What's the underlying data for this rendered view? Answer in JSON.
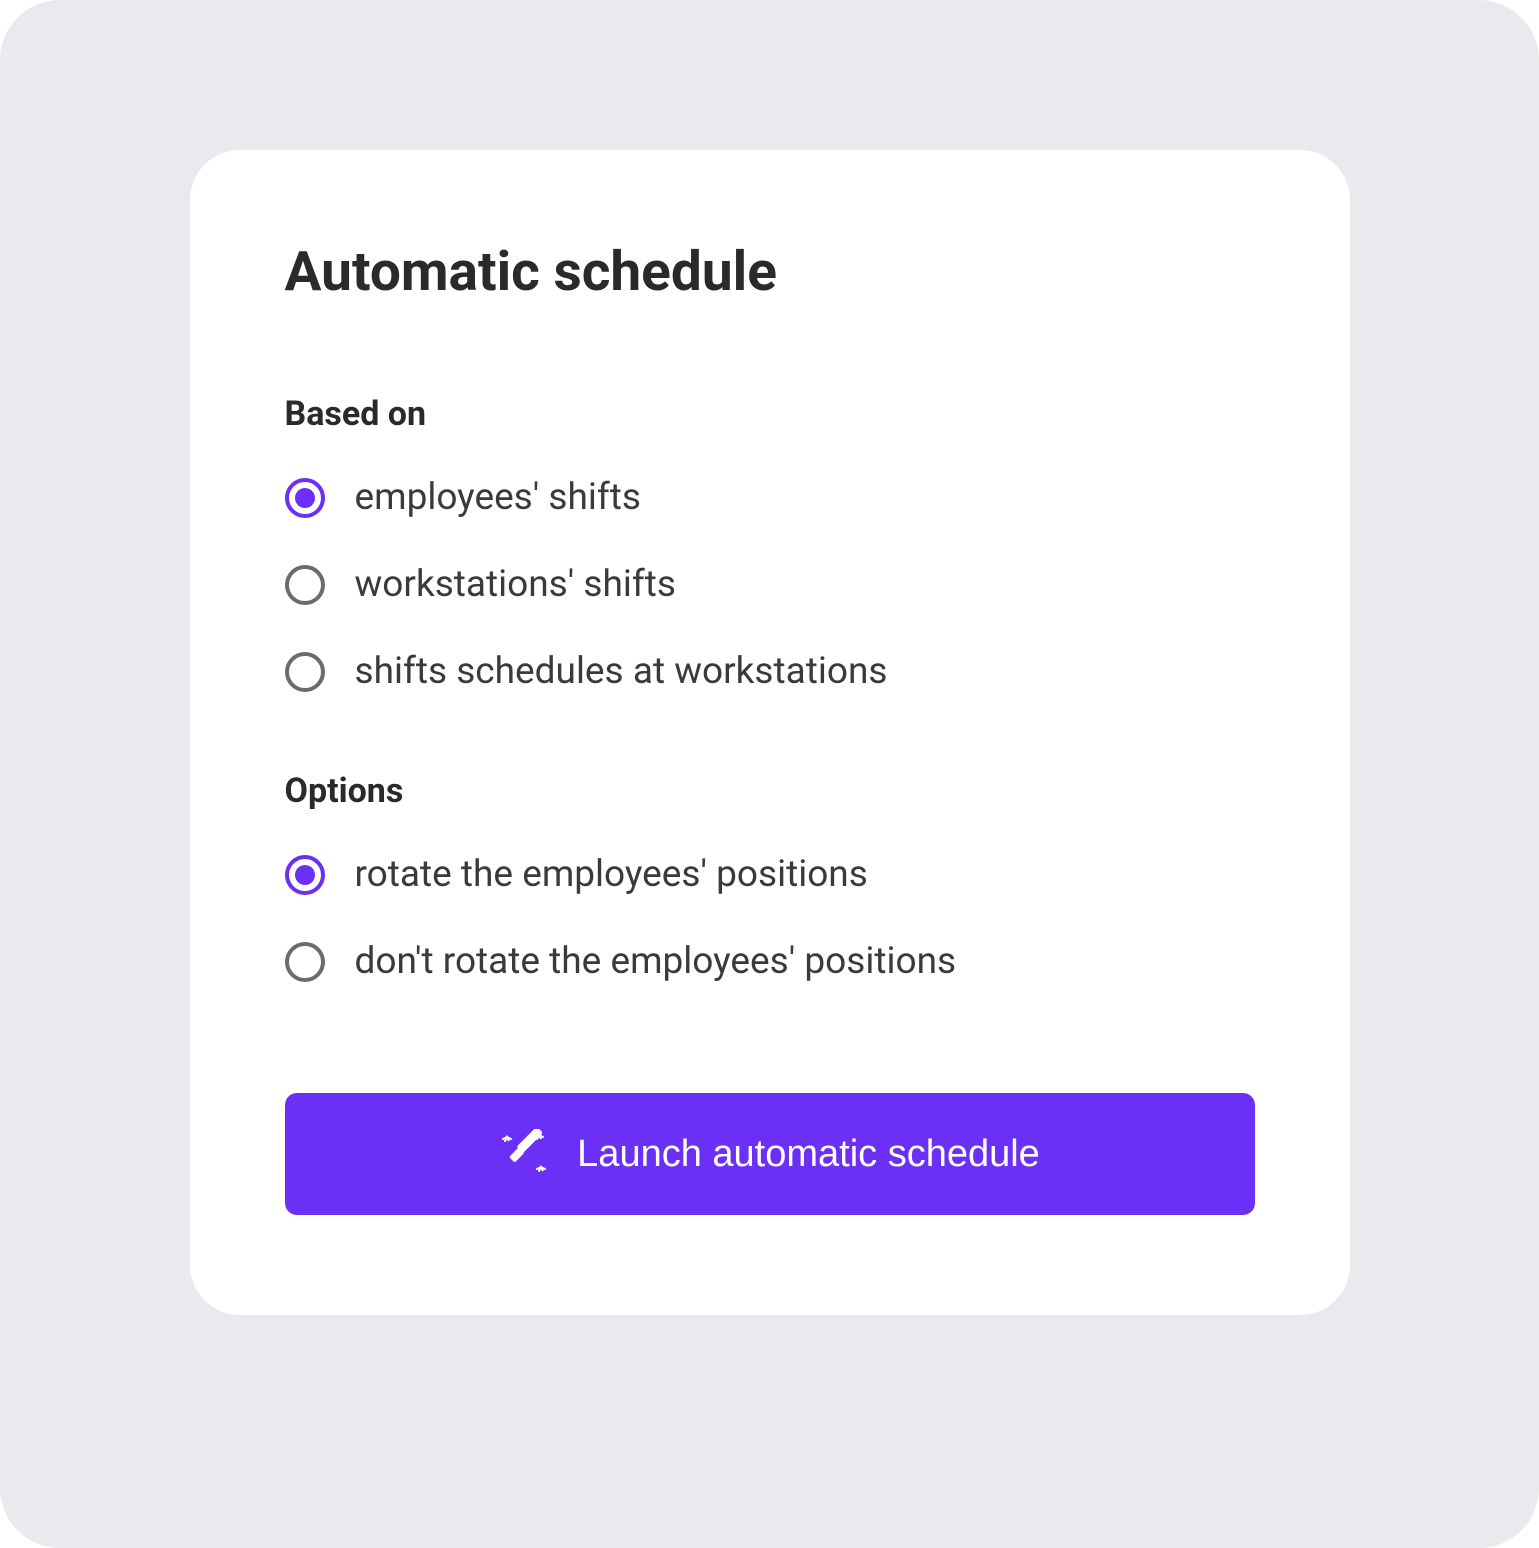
{
  "card": {
    "title": "Automatic schedule",
    "sections": {
      "basedOn": {
        "label": "Based on",
        "options": [
          {
            "label": "employees' shifts",
            "selected": true
          },
          {
            "label": "workstations' shifts",
            "selected": false
          },
          {
            "label": "shifts schedules at workstations",
            "selected": false
          }
        ]
      },
      "options": {
        "label": "Options",
        "options": [
          {
            "label": "rotate the employees' positions",
            "selected": true
          },
          {
            "label": "don't rotate the employees' positions",
            "selected": false
          }
        ]
      }
    },
    "button": {
      "label": "Launch automatic schedule"
    }
  },
  "colors": {
    "accent": "#6b2ff5",
    "background": "#e8eaed",
    "cardBackground": "#ffffff",
    "text": "#2a2a2a",
    "textSecondary": "#3a3a3a",
    "radioBorder": "#6b6b6b"
  }
}
